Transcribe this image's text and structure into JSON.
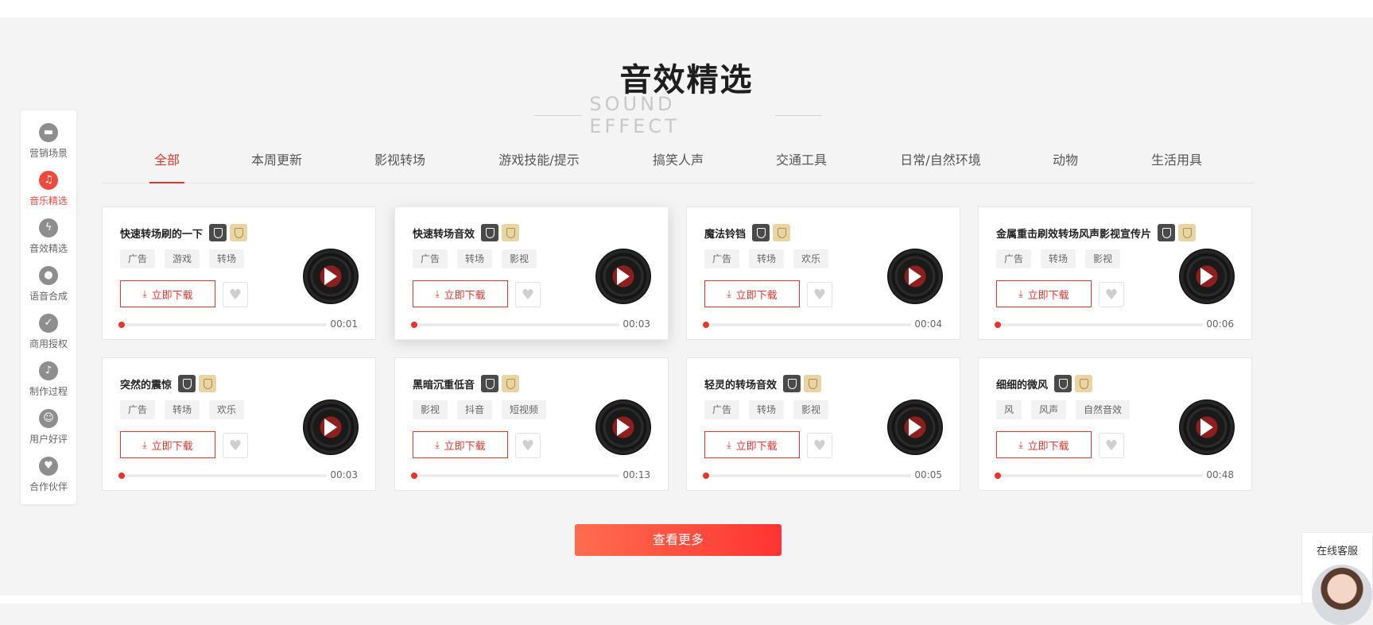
{
  "heading": {
    "title": "音效精选",
    "subtitle": "SOUND EFFECT"
  },
  "tabs": [
    {
      "label": "全部",
      "active": true
    },
    {
      "label": "本周更新"
    },
    {
      "label": "影视转场"
    },
    {
      "label": "游戏技能/提示"
    },
    {
      "label": "搞笑人声"
    },
    {
      "label": "交通工具"
    },
    {
      "label": "日常/自然环境"
    },
    {
      "label": "动物"
    },
    {
      "label": "生活用具"
    }
  ],
  "sidebar": {
    "items": [
      {
        "label": "营销场景",
        "icon": "clapperboard-icon",
        "glyph": "▬"
      },
      {
        "label": "音乐精选",
        "icon": "music-note-icon",
        "glyph": "♫",
        "active": true
      },
      {
        "label": "音效精选",
        "icon": "sound-bolt-icon",
        "glyph": "ϟ"
      },
      {
        "label": "语音合成",
        "icon": "microphone-icon",
        "glyph": "●"
      },
      {
        "label": "商用授权",
        "icon": "shield-check-icon",
        "glyph": "✓"
      },
      {
        "label": "制作过程",
        "icon": "disc-note-icon",
        "glyph": "♪"
      },
      {
        "label": "用户好评",
        "icon": "smiley-icon",
        "glyph": "☺"
      },
      {
        "label": "合作伙伴",
        "icon": "heart-handshake-icon",
        "glyph": "♥"
      }
    ]
  },
  "cards": [
    {
      "title": "快速转场刷的一下",
      "tags": [
        "广告",
        "游戏",
        "转场"
      ],
      "duration": "00:01",
      "download_label": "立即下载"
    },
    {
      "title": "快速转场音效",
      "tags": [
        "广告",
        "转场",
        "影视"
      ],
      "duration": "00:03",
      "download_label": "立即下载"
    },
    {
      "title": "魔法铃铛",
      "tags": [
        "广告",
        "转场",
        "欢乐"
      ],
      "duration": "00:04",
      "download_label": "立即下载"
    },
    {
      "title": "金属重击刷效转场风声影视宣传片",
      "tags": [
        "广告",
        "转场",
        "影视"
      ],
      "duration": "00:06",
      "download_label": "立即下载"
    },
    {
      "title": "突然的震惊",
      "tags": [
        "广告",
        "转场",
        "欢乐"
      ],
      "duration": "00:03",
      "download_label": "立即下载"
    },
    {
      "title": "黑暗沉重低音",
      "tags": [
        "影视",
        "抖音",
        "短视频"
      ],
      "duration": "00:13",
      "download_label": "立即下载"
    },
    {
      "title": "轻灵的转场音效",
      "tags": [
        "广告",
        "转场",
        "影视"
      ],
      "duration": "00:05",
      "download_label": "立即下载"
    },
    {
      "title": "细细的微风",
      "tags": [
        "风",
        "风声",
        "自然音效"
      ],
      "duration": "00:48",
      "download_label": "立即下载"
    }
  ],
  "more_label": "查看更多",
  "service_label": "在线客服",
  "colors": {
    "accent": "#e8352f",
    "background": "#f4f4f4"
  }
}
